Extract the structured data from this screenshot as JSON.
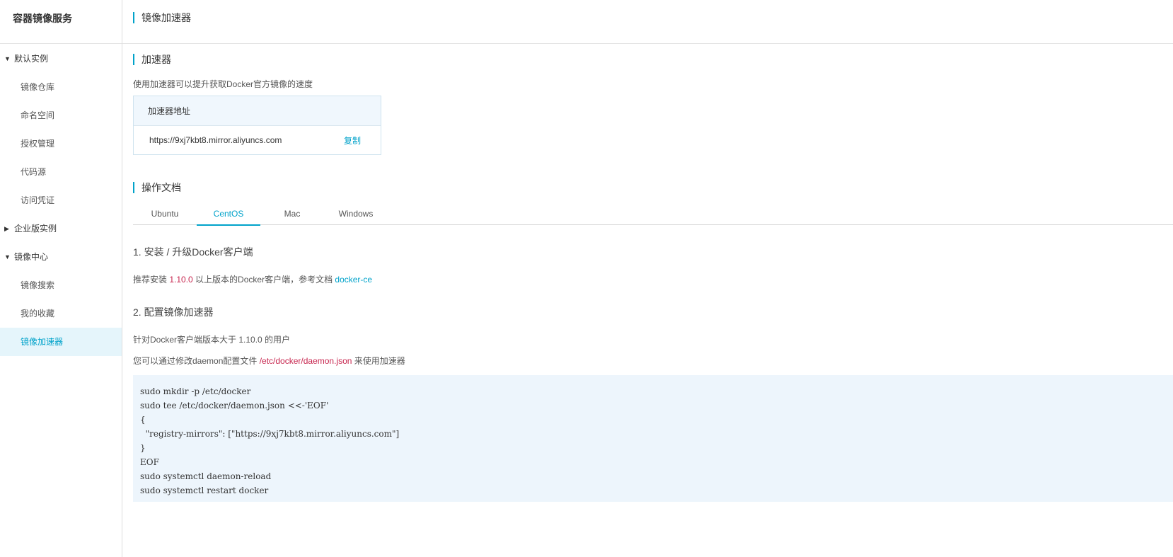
{
  "sidebar": {
    "title": "容器镜像服务",
    "groups": [
      {
        "label": "默认实例",
        "expanded": true,
        "items": [
          {
            "label": "镜像仓库"
          },
          {
            "label": "命名空间"
          },
          {
            "label": "授权管理"
          },
          {
            "label": "代码源"
          },
          {
            "label": "访问凭证"
          }
        ]
      },
      {
        "label": "企业版实例",
        "expanded": false,
        "items": []
      },
      {
        "label": "镜像中心",
        "expanded": true,
        "items": [
          {
            "label": "镜像搜索"
          },
          {
            "label": "我的收藏"
          },
          {
            "label": "镜像加速器",
            "active": true
          }
        ]
      }
    ]
  },
  "header": {
    "title": "镜像加速器"
  },
  "accelerator": {
    "title": "加速器",
    "description": "使用加速器可以提升获取Docker官方镜像的速度",
    "address_header": "加速器地址",
    "address": "https://9xj7kbt8.mirror.aliyuncs.com",
    "copy_label": "复制"
  },
  "docs": {
    "title": "操作文档",
    "tabs": [
      {
        "label": "Ubuntu"
      },
      {
        "label": "CentOS",
        "active": true
      },
      {
        "label": "Mac"
      },
      {
        "label": "Windows"
      }
    ],
    "step1": {
      "title": "1. 安装 / 升级Docker客户端",
      "text_prefix": "推荐安装 ",
      "version": "1.10.0",
      "text_middle": " 以上版本的Docker客户端，参考文档 ",
      "link": "docker-ce"
    },
    "step2": {
      "title": "2. 配置镜像加速器",
      "text1": "针对Docker客户端版本大于 1.10.0 的用户",
      "text2_prefix": "您可以通过修改daemon配置文件 ",
      "config_path": "/etc/docker/daemon.json",
      "text2_suffix": " 来使用加速器",
      "code_lines": [
        "sudo mkdir -p /etc/docker",
        "sudo tee /etc/docker/daemon.json <<-'EOF'",
        "{",
        "  \"registry-mirrors\": [\"https://9xj7kbt8.mirror.aliyuncs.com\"]",
        "}",
        "EOF",
        "sudo systemctl daemon-reload",
        "sudo systemctl restart docker"
      ]
    }
  },
  "colors": {
    "accent": "#00a2ca",
    "highlight_red": "#c7254e",
    "active_bg": "#e5f5fb",
    "code_bg": "#edf5fc"
  }
}
